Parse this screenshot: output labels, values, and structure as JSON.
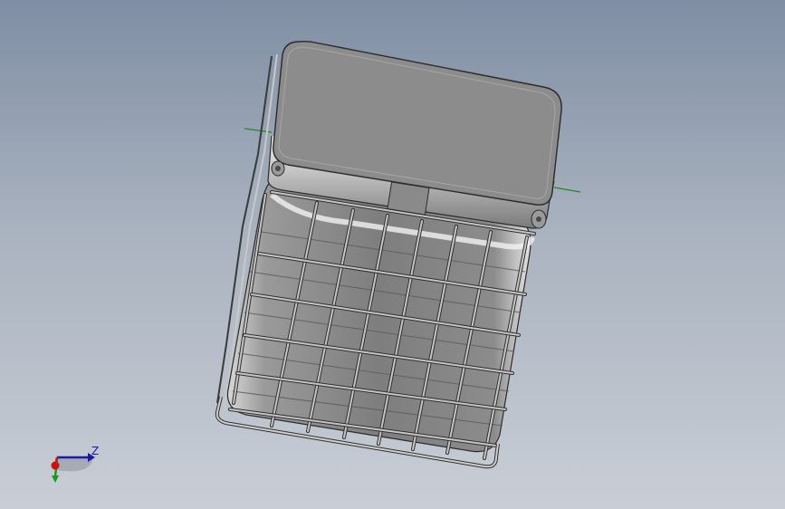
{
  "viewport": {
    "background_top": "#7f8ea4",
    "background_bottom": "#c9ced6"
  },
  "model": {
    "body_color": "#8a8a8a",
    "lid_color": "#8c8c8c",
    "cage_color": "#b9b9b9",
    "edge_color": "#2a2a2a",
    "axis_line_color": "#1f8a1f"
  },
  "triad": {
    "z_label": "Z",
    "z_color": "#1a1aa8",
    "y_color": "#1a9a1a",
    "x_color": "#d01010"
  }
}
